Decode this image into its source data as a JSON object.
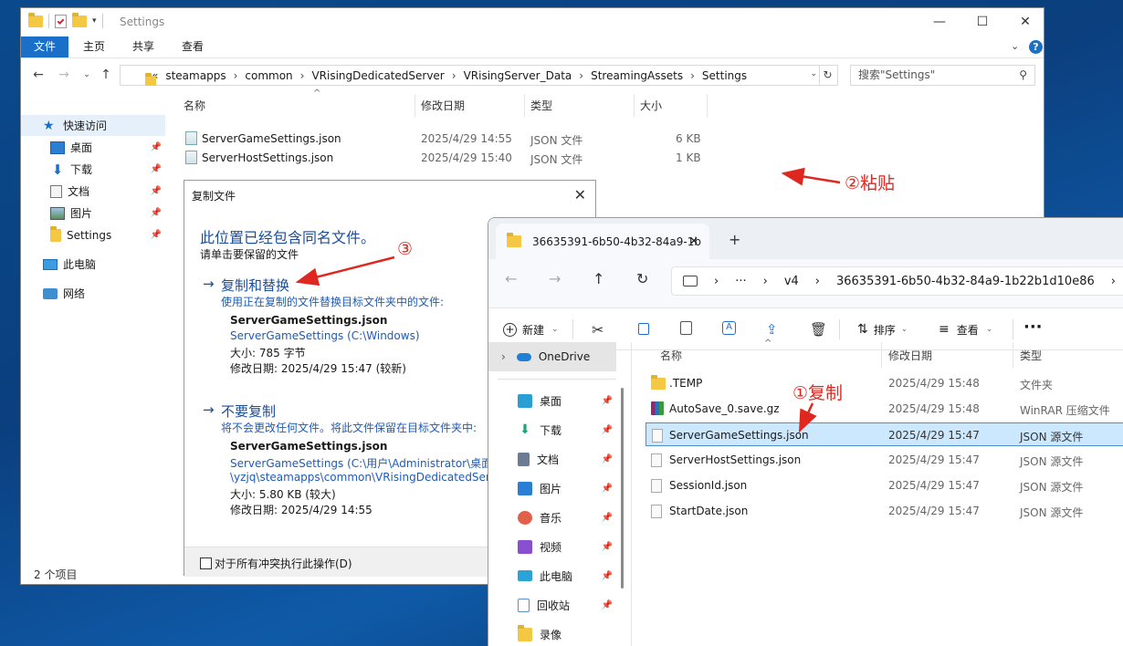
{
  "win10": {
    "title": "Settings",
    "ribbon_tabs": [
      "文件",
      "主页",
      "共享",
      "查看"
    ],
    "path": [
      "«",
      "steamapps",
      "common",
      "VRisingDedicatedServer",
      "VRisingServer_Data",
      "StreamingAssets",
      "Settings"
    ],
    "search_placeholder": "搜索\"Settings\"",
    "nav": [
      {
        "label": "快速访问",
        "pinned": false
      },
      {
        "label": "桌面",
        "pinned": true
      },
      {
        "label": "下载",
        "pinned": true
      },
      {
        "label": "文档",
        "pinned": true
      },
      {
        "label": "图片",
        "pinned": true
      },
      {
        "label": "Settings",
        "pinned": true
      },
      {
        "label": "此电脑",
        "pinned": false
      },
      {
        "label": "网络",
        "pinned": false
      }
    ],
    "columns": [
      "名称",
      "修改日期",
      "类型",
      "大小"
    ],
    "files": [
      {
        "name": "ServerGameSettings.json",
        "date": "2025/4/29 14:55",
        "type": "JSON 文件",
        "size": "6 KB"
      },
      {
        "name": "ServerHostSettings.json",
        "date": "2025/4/29 15:40",
        "type": "JSON 文件",
        "size": "1 KB"
      }
    ],
    "status": "2 个项目"
  },
  "dialog": {
    "title": "复制文件",
    "heading": "此位置已经包含同名文件。",
    "subheading": "请单击要保留的文件",
    "replace": {
      "title": "复制和替换",
      "desc": "使用正在复制的文件替换目标文件夹中的文件:",
      "file": "ServerGameSettings.json",
      "loc": "ServerGameSettings (C:\\Windows)",
      "size": "大小: 785 字节",
      "date": "修改日期: 2025/4/29 15:47 (较新)"
    },
    "skip": {
      "title": "不要复制",
      "desc": "将不会更改任何文件。将此文件保留在目标文件夹中:",
      "file": "ServerGameSettings.json",
      "loc1": "ServerGameSettings (C:\\用户\\Administrator\\桌面",
      "loc2": "\\yzjq\\steamapps\\common\\VRisingDedicatedServ",
      "size": "大小: 5.80 KB (较大)",
      "date": "修改日期: 2025/4/29 14:55"
    },
    "checkbox_label": "对于所有冲突执行此操作(D)"
  },
  "win11": {
    "tab_title": "36635391-6b50-4b32-84a9-1b",
    "path": [
      "v4",
      "36635391-6b50-4b32-84a9-1b22b1d10e86"
    ],
    "cmd": {
      "new": "新建",
      "sort": "排序",
      "view": "查看"
    },
    "nav": [
      {
        "label": "OneDrive",
        "pinned": false,
        "color": "#1f7fd8"
      },
      {
        "label": "桌面",
        "pinned": true,
        "color": "#2a9fd6"
      },
      {
        "label": "下载",
        "pinned": true,
        "color": "#1aa37a"
      },
      {
        "label": "文档",
        "pinned": true,
        "color": "#6b7b94"
      },
      {
        "label": "图片",
        "pinned": true,
        "color": "#2b7ed6"
      },
      {
        "label": "音乐",
        "pinned": true,
        "color": "#e2604a"
      },
      {
        "label": "视频",
        "pinned": true,
        "color": "#8a4fd0"
      },
      {
        "label": "此电脑",
        "pinned": true,
        "color": "#2aa3d9"
      },
      {
        "label": "回收站",
        "pinned": true,
        "color": "#5a8fc9"
      },
      {
        "label": "录像",
        "pinned": false,
        "color": "#f4c842"
      }
    ],
    "columns": [
      "名称",
      "修改日期",
      "类型"
    ],
    "files": [
      {
        "name": ".TEMP",
        "date": "2025/4/29 15:48",
        "type": "文件夹",
        "kind": "folder"
      },
      {
        "name": "AutoSave_0.save.gz",
        "date": "2025/4/29 15:48",
        "type": "WinRAR 压缩文件",
        "kind": "rar"
      },
      {
        "name": "ServerGameSettings.json",
        "date": "2025/4/29 15:47",
        "type": "JSON 源文件",
        "kind": "json"
      },
      {
        "name": "ServerHostSettings.json",
        "date": "2025/4/29 15:47",
        "type": "JSON 源文件",
        "kind": "json"
      },
      {
        "name": "SessionId.json",
        "date": "2025/4/29 15:47",
        "type": "JSON 源文件",
        "kind": "json"
      },
      {
        "name": "StartDate.json",
        "date": "2025/4/29 15:47",
        "type": "JSON 源文件",
        "kind": "json"
      }
    ],
    "selected_index": 2
  },
  "annotations": {
    "copy": "①复制",
    "paste": "②粘贴",
    "replace": "③"
  }
}
